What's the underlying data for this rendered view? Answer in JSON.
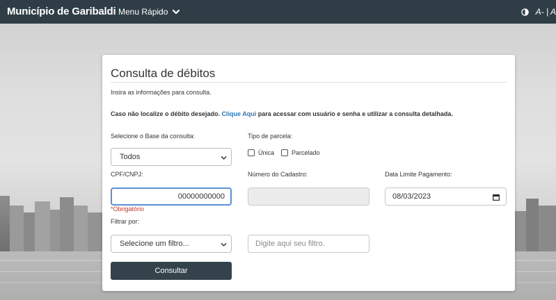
{
  "header": {
    "brand": "Município de Garibaldi",
    "quick_menu_label": "Menu Rápido",
    "font_size_label": "A- | A"
  },
  "form": {
    "title": "Consulta de débitos",
    "subtitle": "Insira as informações para consulta.",
    "notice_prefix": "Caso não localize o débito desejado. ",
    "notice_link": "Clique Aqui",
    "notice_suffix": " para acessar com usuário e senha e utilizar a consulta detalhada.",
    "base_label": "Selecione o Base da consulta:",
    "base_value": "Todos",
    "parcel_label": "Tipo de parcela:",
    "parcel_options": [
      "Única",
      "Parcelado"
    ],
    "cpf_label": "CPF/CNPJ:",
    "cpf_value": "00000000000",
    "cpf_required": "*Obrigatório",
    "cadastro_label": "Número do Cadastro:",
    "cadastro_value": "",
    "due_date_label": "Data Limite Pagamento:",
    "due_date_value": "08/03/2023",
    "filter_label": "Filtrar por:",
    "filter_select_value": "Selecione um filtro...",
    "filter_input_placeholder": "Digite aqui seu filtro.",
    "submit_label": "Consultar"
  },
  "colors": {
    "topbar": "#2f3e46",
    "link": "#2f78b5",
    "required": "#c0392b",
    "button": "#34434b",
    "focus_border": "#5a8fd6"
  }
}
